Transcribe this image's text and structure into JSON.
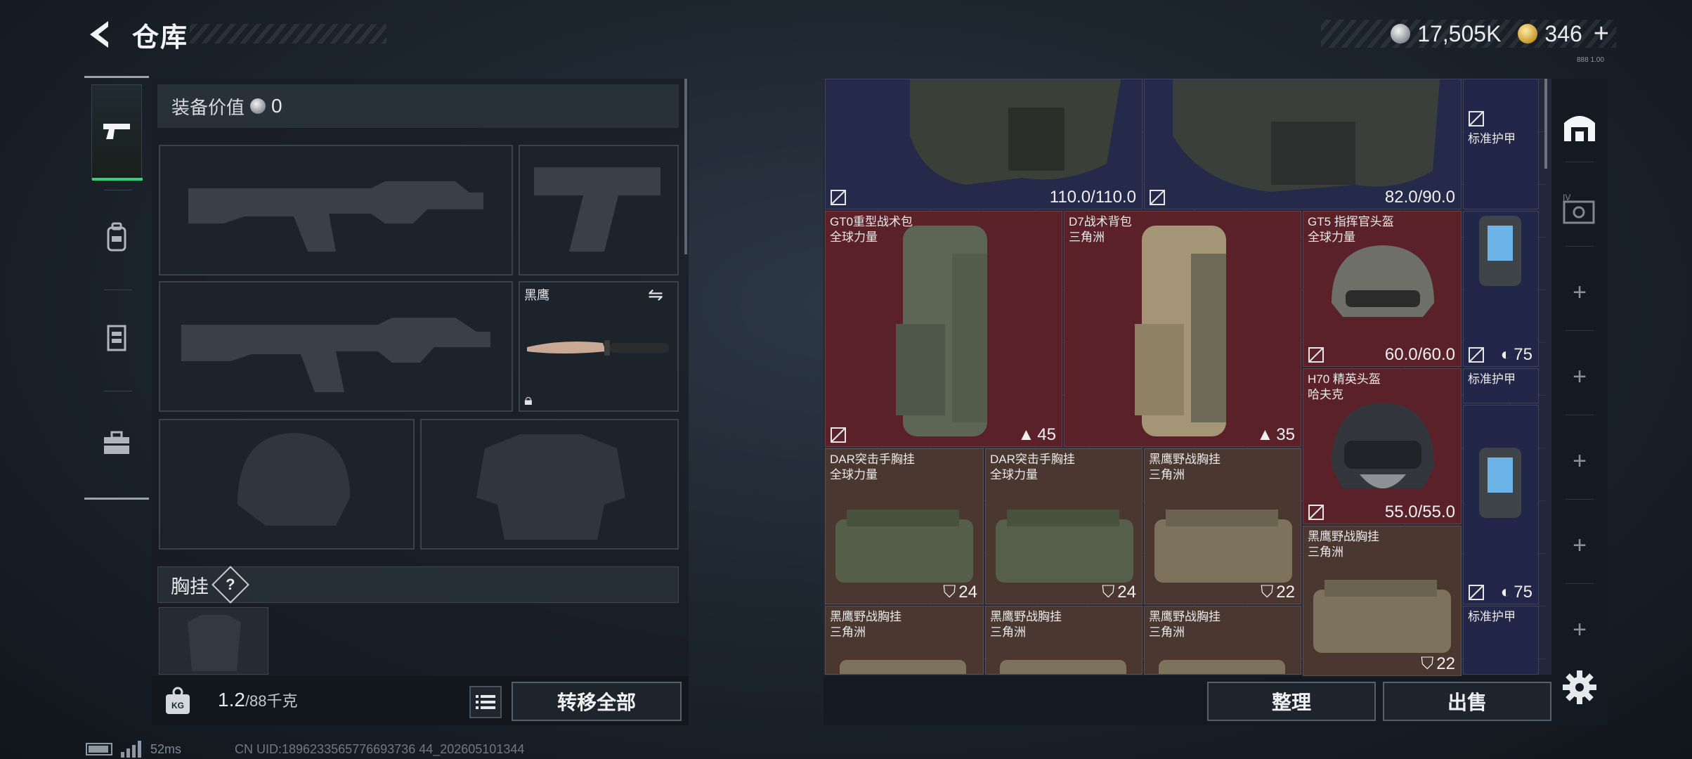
{
  "header": {
    "title": "仓库",
    "currency_silver": "17,505K",
    "currency_gold": "346",
    "plus": "+",
    "tiny_code": "888 1.00"
  },
  "equip": {
    "value_label": "装备价值",
    "value": "0",
    "knife_name": "黑鹰",
    "chest_label": "胸挂",
    "help": "?",
    "weight": "1.2",
    "weight_max": "/88千克",
    "kg_label": "KG",
    "transfer_all": "转移全部"
  },
  "status": {
    "ping": "52ms",
    "uid": "CN UID:1896233565776693736 44_202605101344"
  },
  "stash": {
    "items": [
      {
        "name": "",
        "sub": "",
        "stat": "110.0/110.0",
        "type": "armor"
      },
      {
        "name": "",
        "sub": "",
        "stat": "82.0/90.0",
        "type": "armor"
      },
      {
        "name": "标准护甲",
        "sub": "",
        "stat": "",
        "type": "plate"
      },
      {
        "name": "GT0重型战术包",
        "sub": "全球力量",
        "stat": "45",
        "type": "bag"
      },
      {
        "name": "D7战术背包",
        "sub": "三角洲",
        "stat": "35",
        "type": "bag"
      },
      {
        "name": "GT5 指挥官头盔",
        "sub": "全球力量",
        "stat": "60.0/60.0",
        "type": "helmet"
      },
      {
        "name": "",
        "sub": "",
        "stat": "75",
        "type": "plate"
      },
      {
        "name": "标准护甲",
        "sub": "",
        "stat": "",
        "type": "plate"
      },
      {
        "name": "H70 精英头盔",
        "sub": "哈夫克",
        "stat": "55.0/55.0",
        "type": "helmet"
      },
      {
        "name": "DAR突击手胸挂",
        "sub": "全球力量",
        "stat": "24",
        "type": "vest"
      },
      {
        "name": "DAR突击手胸挂",
        "sub": "全球力量",
        "stat": "24",
        "type": "vest"
      },
      {
        "name": "黑鹰野战胸挂",
        "sub": "三角洲",
        "stat": "22",
        "type": "vest"
      },
      {
        "name": "黑鹰野战胸挂",
        "sub": "三角洲",
        "stat": "22",
        "type": "vest"
      },
      {
        "name": "",
        "sub": "",
        "stat": "75",
        "type": "plate"
      },
      {
        "name": "标准护甲",
        "sub": "",
        "stat": "",
        "type": "plate"
      },
      {
        "name": "黑鹰野战胸挂",
        "sub": "三角洲",
        "stat": "",
        "type": "vest"
      },
      {
        "name": "黑鹰野战胸挂",
        "sub": "三角洲",
        "stat": "",
        "type": "vest"
      },
      {
        "name": "黑鹰野战胸挂",
        "sub": "三角洲",
        "stat": "",
        "type": "vest"
      }
    ],
    "sort": "整理",
    "sell": "出售"
  },
  "colors": {
    "accent_green": "#2fd279",
    "bag_red": "#5a2228",
    "vest_brown": "#4a3830",
    "armor_blue": "#25294a"
  }
}
